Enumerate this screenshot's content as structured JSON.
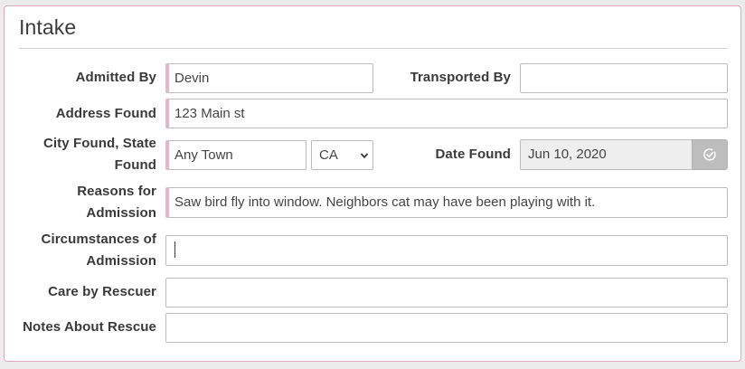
{
  "panel": {
    "title": "Intake"
  },
  "form": {
    "admitted_by": {
      "label": "Admitted By",
      "value": "Devin"
    },
    "transported_by": {
      "label": "Transported By",
      "value": ""
    },
    "address_found": {
      "label": "Address Found",
      "value": "123 Main st"
    },
    "city_state": {
      "label_line1": "City Found, State",
      "label_line2": "Found",
      "city_value": "Any Town",
      "state_value": "CA"
    },
    "date_found": {
      "label": "Date Found",
      "value": "Jun 10, 2020"
    },
    "reasons": {
      "label_line1": "Reasons for",
      "label_line2": "Admission",
      "value": "Saw bird fly into window. Neighbors cat may have been playing with it."
    },
    "circumstances": {
      "label_line1": "Circumstances of",
      "label_line2": "Admission",
      "value": ""
    },
    "care_by_rescuer": {
      "label": "Care by Rescuer",
      "value": ""
    },
    "notes_about_rescue": {
      "label": "Notes About Rescue",
      "value": ""
    }
  },
  "colors": {
    "required_marker": "#e7b6c7",
    "panel_border": "#e3a9bd",
    "date_bg": "#eeeeee",
    "calendar_button": "#bdbdbd"
  },
  "icons": {
    "calendar_button": "check-circle-icon",
    "select_arrow": "chevron-down-icon"
  }
}
